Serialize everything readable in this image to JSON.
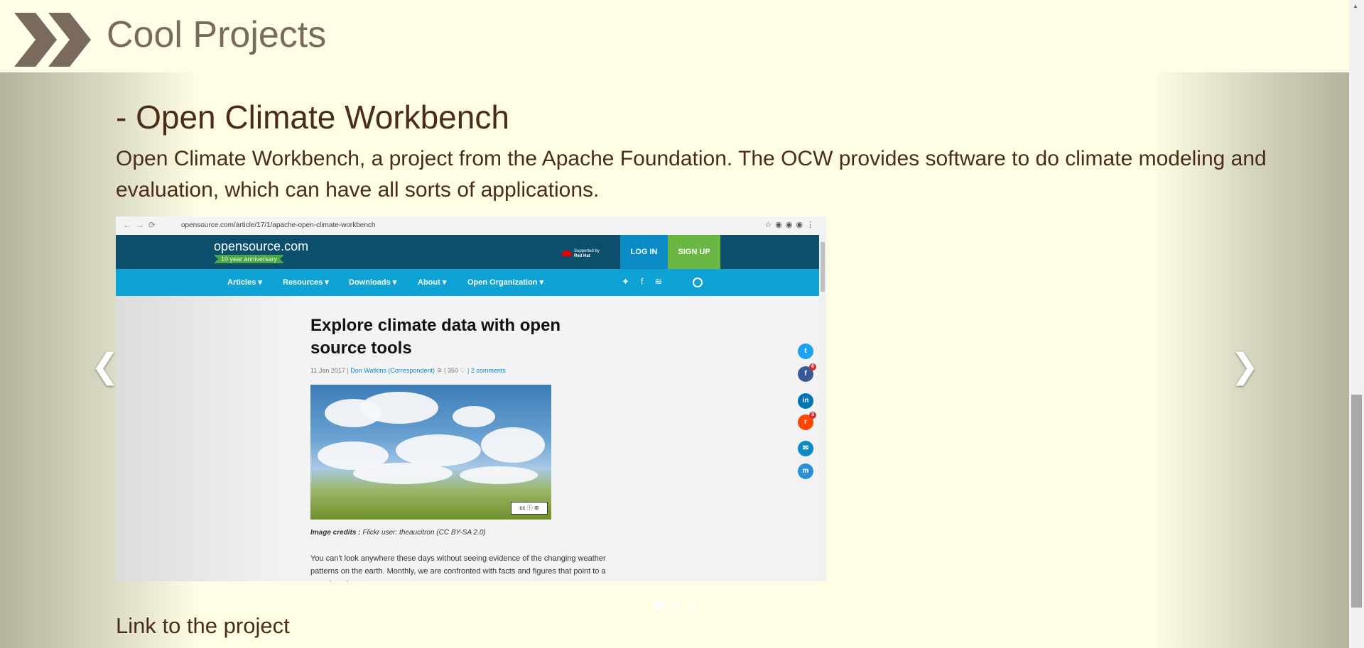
{
  "header": {
    "site_title": "Cool Projects",
    "logo_icon": "double-chevron-right-icon"
  },
  "slide": {
    "title": "- Open Climate Workbench",
    "description": "Open Climate Workbench, a project from the Apache Foundation. The OCW provides software to do climate modeling and evaluation, which can have all sorts of applications.",
    "link_text": "Link to the project"
  },
  "carousel": {
    "prev_icon": "chevron-left-icon",
    "next_icon": "chevron-right-icon",
    "indicator_count": 3,
    "active_index": 0
  },
  "screenshot": {
    "url": "opensource.com/article/17/1/apache-open-climate-workbench",
    "brand": "opensource.com",
    "anniversary": "10 year anniversary",
    "supported_by": "Supported by",
    "red_hat": "Red Hat",
    "login": "LOG IN",
    "signup": "SIGN UP",
    "nav": [
      "Articles ▾",
      "Resources ▾",
      "Downloads ▾",
      "About ▾",
      "Open Organization ▾"
    ],
    "article_title": "Explore climate data with open source tools",
    "meta_date": "11 Jan 2017",
    "meta_author": "Don Watkins (Correspondent)",
    "meta_likes": "350",
    "meta_comments": "2 comments",
    "credit_label": "Image credits :",
    "credit_text": " Flickr user: theaucitron (CC BY-SA 2.0)",
    "body_text": "You can't look anywhere these days without seeing evidence of the changing weather patterns on the earth. Monthly, we are confronted with facts and figures that point to a warming planet.",
    "facebook_count": "6",
    "reddit_count": "3"
  },
  "colors": {
    "header_bg": "#fffde3",
    "title_text": "#4a2d17",
    "site_title": "#7a6a5c",
    "osc_dark": "#0b4f6d",
    "osc_nav": "#0fa2d5",
    "signup_green": "#6bb743"
  }
}
